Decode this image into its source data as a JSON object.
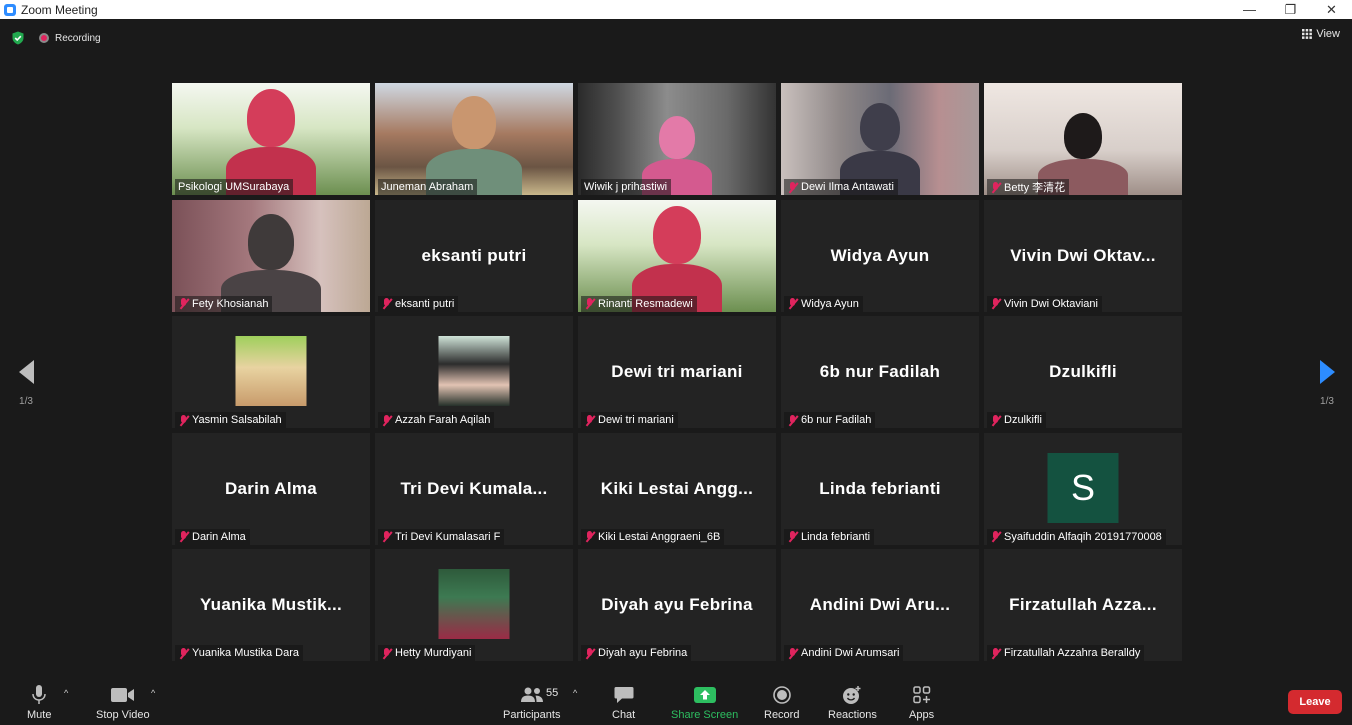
{
  "window": {
    "title": "Zoom Meeting",
    "minimize": "—",
    "restore": "❐",
    "close": "✕"
  },
  "topbar": {
    "recording_label": "Recording",
    "view_label": "View"
  },
  "pagination": {
    "left": "1/3",
    "right": "1/3"
  },
  "tiles": [
    {
      "name": "Psikologi UMSurabaya",
      "bigname": "",
      "muted": false,
      "video": "v-green"
    },
    {
      "name": "Juneman Abraham",
      "bigname": "",
      "muted": false,
      "video": "v-building"
    },
    {
      "name": "Wiwik j prihastiwi",
      "bigname": "",
      "muted": false,
      "video": "v-grey",
      "active": true
    },
    {
      "name": "Dewi Ilma Antawati",
      "bigname": "",
      "muted": true,
      "video": "v-blur"
    },
    {
      "name": "Betty 李清花",
      "bigname": "",
      "muted": true,
      "video": "v-wall"
    },
    {
      "name": "Fety Khosianah",
      "bigname": "",
      "muted": true,
      "video": "v-pink"
    },
    {
      "name": "eksanti putri",
      "bigname": "eksanti putri",
      "muted": true
    },
    {
      "name": "Rinanti Resmadewi",
      "bigname": "",
      "muted": true,
      "video": "v-green"
    },
    {
      "name": "Widya Ayun",
      "bigname": "Widya Ayun",
      "muted": true
    },
    {
      "name": "Vivin Dwi Oktaviani",
      "bigname": "Vivin  Dwi  Oktav...",
      "muted": true
    },
    {
      "name": "Yasmin Salsabilah",
      "bigname": "",
      "muted": true,
      "thumb": "yasmin"
    },
    {
      "name": "Azzah Farah Aqilah",
      "bigname": "",
      "muted": true,
      "thumb": "azzah"
    },
    {
      "name": "Dewi tri mariani",
      "bigname": "Dewi tri mariani",
      "muted": true
    },
    {
      "name": "6b nur Fadilah",
      "bigname": "6b nur Fadilah",
      "muted": true
    },
    {
      "name": "Dzulkifli",
      "bigname": "Dzulkifli",
      "muted": true
    },
    {
      "name": "Darin Alma",
      "bigname": "Darin Alma",
      "muted": true
    },
    {
      "name": "Tri Devi Kumalasari F",
      "bigname": "Tri  Devi  Kumala...",
      "muted": true
    },
    {
      "name": "Kiki Lestai Anggraeni_6B",
      "bigname": "Kiki  Lestai  Angg...",
      "muted": true
    },
    {
      "name": "Linda febrianti",
      "bigname": "Linda febrianti",
      "muted": true
    },
    {
      "name": "Syaifuddin Alfaqih 20191770008",
      "bigname": "",
      "muted": true,
      "avatar": "S"
    },
    {
      "name": "Yuanika Mustika Dara",
      "bigname": "Yuanika  Mustik...",
      "muted": true
    },
    {
      "name": "Hetty Murdiyani",
      "bigname": "",
      "muted": true,
      "thumb": "hetty"
    },
    {
      "name": "Diyah ayu Febrina",
      "bigname": "Diyah ayu Febrina",
      "muted": true
    },
    {
      "name": "Andini Dwi Arumsari",
      "bigname": "Andini  Dwi  Aru...",
      "muted": true
    },
    {
      "name": "Firzatullah Azzahra Beralldy",
      "bigname": "Firzatullah  Azza...",
      "muted": true
    }
  ],
  "toolbar": {
    "mute": "Mute",
    "stop_video": "Stop Video",
    "participants": "Participants",
    "participants_count": "55",
    "chat": "Chat",
    "share_screen": "Share Screen",
    "record": "Record",
    "reactions": "Reactions",
    "apps": "Apps",
    "leave": "Leave"
  },
  "colors": {
    "accent": "#2d8cff",
    "active_speaker": "#c6d84a",
    "muted": "#e0245e",
    "share": "#2dbe60",
    "leave": "#d42a2f"
  }
}
